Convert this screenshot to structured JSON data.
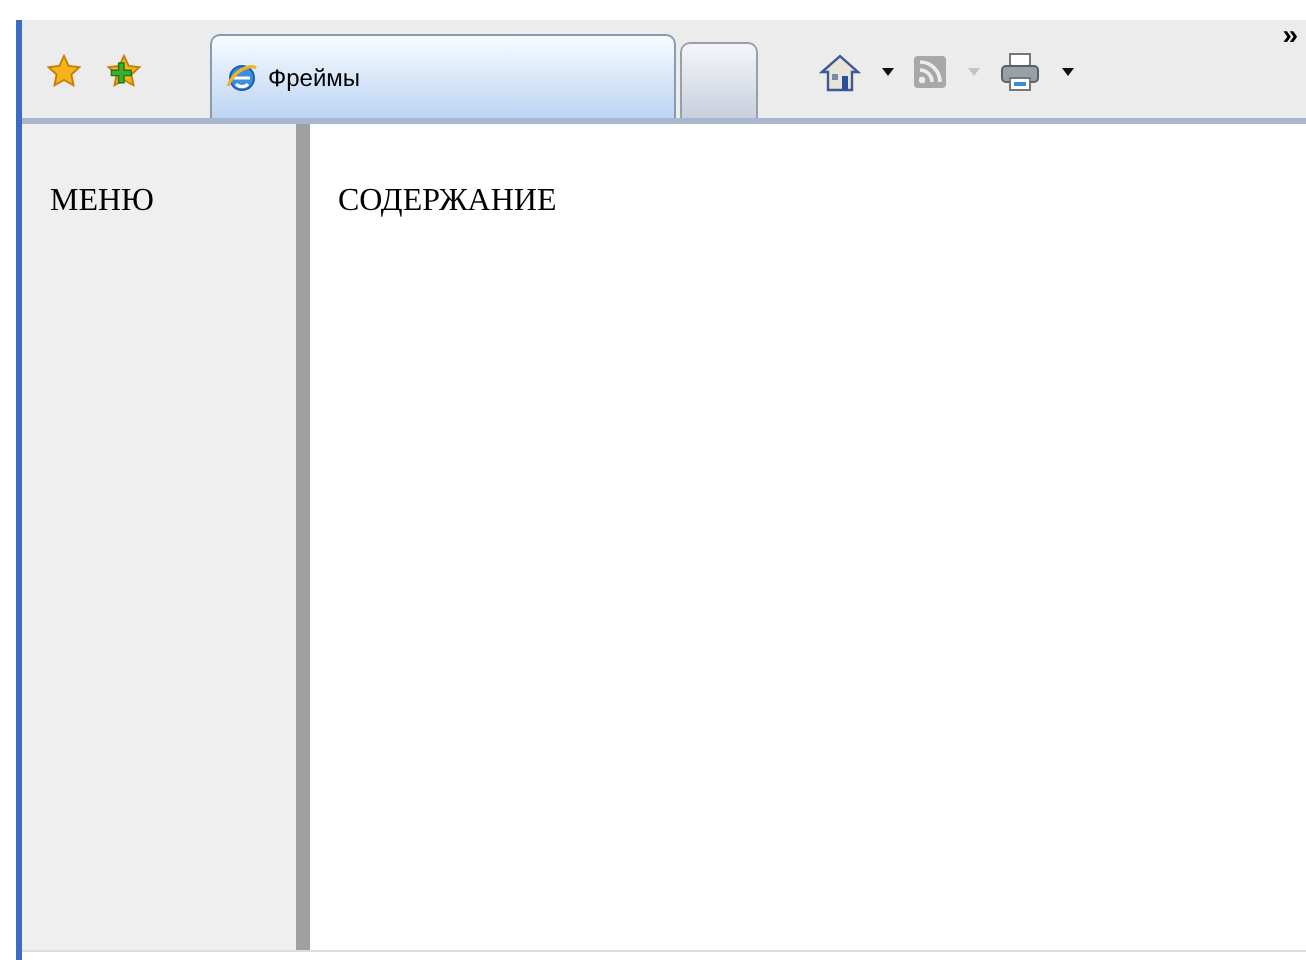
{
  "tabs": [
    {
      "kind": "page",
      "label": "Фреймы",
      "selected": true
    },
    {
      "kind": "new-tab",
      "selected": false
    }
  ],
  "toolbar": [
    {
      "kind": "home",
      "disabled": false
    },
    {
      "kind": "feeds",
      "disabled": true
    },
    {
      "kind": "print",
      "disabled": false
    }
  ],
  "overflow": "»",
  "frames": {
    "menu": "МЕНЮ",
    "content": "СОДЕРЖАНИЕ"
  }
}
